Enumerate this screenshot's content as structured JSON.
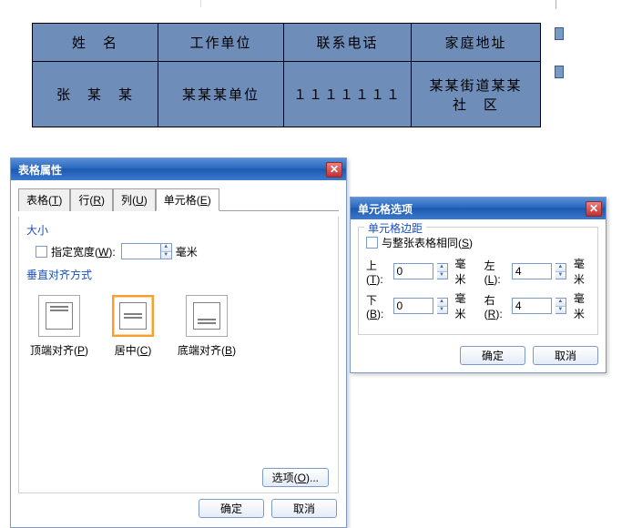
{
  "table": {
    "headers": [
      "姓　名",
      "工作单位",
      "联系电话",
      "家庭地址"
    ],
    "row": [
      "张　某　某",
      "某某某单位",
      "１１１１１１１",
      "某某街道某某　社　区"
    ]
  },
  "table_props": {
    "title": "表格属性",
    "tabs": {
      "table": {
        "label": "表格",
        "accel": "T"
      },
      "row": {
        "label": "行",
        "accel": "R"
      },
      "column": {
        "label": "列",
        "accel": "U"
      },
      "cell": {
        "label": "单元格",
        "accel": "E"
      }
    },
    "size_section": "大小",
    "width_label": "指定宽度",
    "width_accel": "W",
    "width_value": "",
    "width_unit": "毫米",
    "valign_section": "垂直对齐方式",
    "valign": {
      "top": {
        "label": "顶端对齐",
        "accel": "P"
      },
      "center": {
        "label": "居中",
        "accel": "C"
      },
      "bottom": {
        "label": "底端对齐",
        "accel": "B"
      }
    },
    "options_btn": "选项",
    "options_accel": "O",
    "ok": "确定",
    "cancel": "取消"
  },
  "cell_options": {
    "title": "单元格选项",
    "group": "单元格边距",
    "same_as_table": "与整张表格相同",
    "same_accel": "S",
    "top": {
      "label": "上",
      "accel": "T",
      "value": "0",
      "unit": "毫米"
    },
    "bottom": {
      "label": "下",
      "accel": "B",
      "value": "0",
      "unit": "毫米"
    },
    "left": {
      "label": "左",
      "accel": "L",
      "value": "4",
      "unit": "毫米"
    },
    "right": {
      "label": "右",
      "accel": "R",
      "value": "4",
      "unit": "毫米"
    },
    "ok": "确定",
    "cancel": "取消"
  }
}
